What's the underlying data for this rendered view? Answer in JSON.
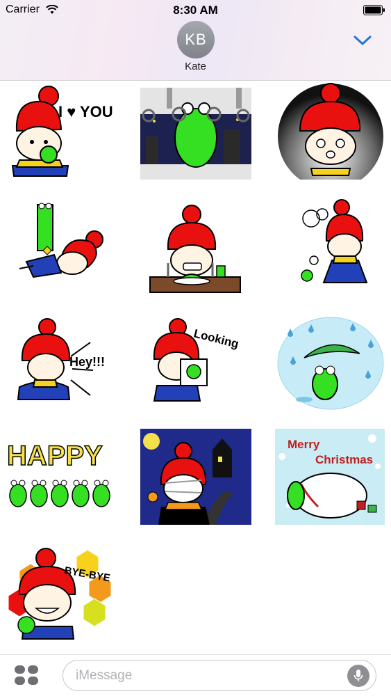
{
  "status_bar": {
    "carrier": "Carrier",
    "time": "8:30 AM"
  },
  "contact": {
    "initials": "KB",
    "name": "Kate"
  },
  "stickers": [
    {
      "name": "sticker-i-love-you",
      "text": "I ♥ YOU"
    },
    {
      "name": "sticker-frog-train",
      "text": ""
    },
    {
      "name": "sticker-shocked-girl",
      "text": ""
    },
    {
      "name": "sticker-frog-stack",
      "text": ""
    },
    {
      "name": "sticker-girl-eating",
      "text": ""
    },
    {
      "name": "sticker-girl-steaming",
      "text": ""
    },
    {
      "name": "sticker-hey",
      "text": "Hey!!!"
    },
    {
      "name": "sticker-looking",
      "text": "Looking"
    },
    {
      "name": "sticker-frog-rain",
      "text": ""
    },
    {
      "name": "sticker-happy-frogs",
      "text": "HAPPY"
    },
    {
      "name": "sticker-halloween",
      "text": ""
    },
    {
      "name": "sticker-merry-christmas",
      "text_line1": "Merry",
      "text_line2": "Christmas"
    },
    {
      "name": "sticker-bye-bye",
      "text": "BYE-BYE"
    }
  ],
  "footer": {
    "placeholder": "iMessage"
  },
  "colors": {
    "accent": "#1a76e3",
    "girl_hair": "#e8110f",
    "frog": "#35e023",
    "dress": "#2240b8"
  }
}
